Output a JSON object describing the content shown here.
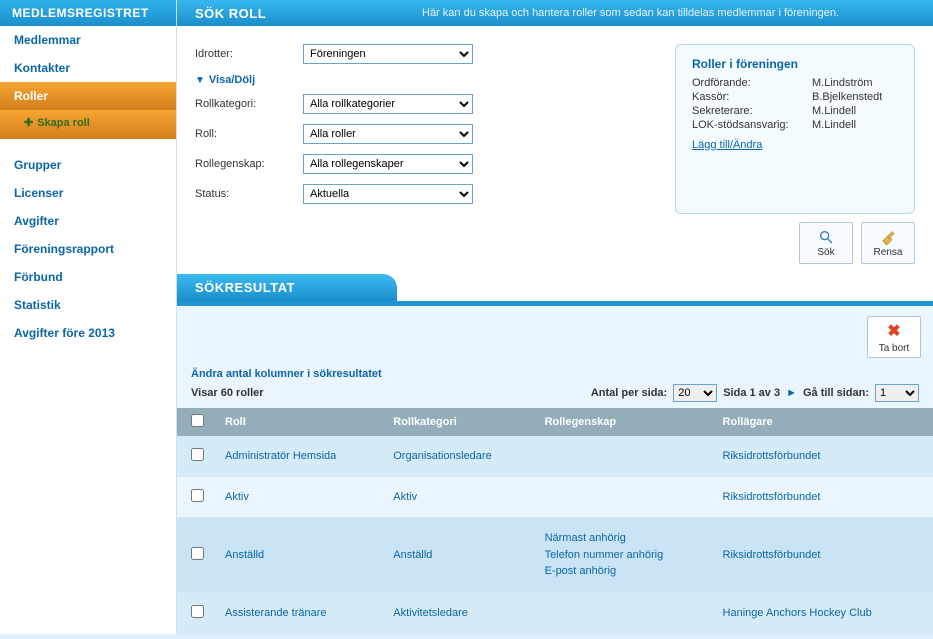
{
  "sidebar": {
    "header": "MEDLEMSREGISTRET",
    "items": [
      {
        "label": "Medlemmar"
      },
      {
        "label": "Kontakter"
      },
      {
        "label": "Roller",
        "active": true,
        "sub": "Skapa roll"
      },
      {
        "label": "Grupper"
      },
      {
        "label": "Licenser"
      },
      {
        "label": "Avgifter"
      },
      {
        "label": "Föreningsrapport"
      },
      {
        "label": "Förbund"
      },
      {
        "label": "Statistik"
      },
      {
        "label": "Avgifter före 2013"
      }
    ]
  },
  "topbar": {
    "title": "SÖK ROLL",
    "desc": "Här kan du skapa och hantera roller som sedan kan tilldelas medlemmar i föreningen."
  },
  "filters": {
    "idrotter_label": "Idrotter:",
    "idrotter_value": "Föreningen",
    "toggle_label": "Visa/Dölj",
    "rollkategori_label": "Rollkategori:",
    "rollkategori_value": "Alla rollkategorier",
    "roll_label": "Roll:",
    "roll_value": "Alla roller",
    "rollegenskap_label": "Rollegenskap:",
    "rollegenskap_value": "Alla rollegenskaper",
    "status_label": "Status:",
    "status_value": "Aktuella"
  },
  "rolebox": {
    "title": "Roller i föreningen",
    "rows": [
      {
        "k": "Ordförande:",
        "v": "M.Lindström"
      },
      {
        "k": "Kassör:",
        "v": "B.Bjelkenstedt"
      },
      {
        "k": "Sekreterare:",
        "v": "M.Lindell"
      },
      {
        "k": "LOK-stödsansvarig:",
        "v": "M.Lindell"
      }
    ],
    "link": "Lägg till/Ändra"
  },
  "buttons": {
    "search": "Sök",
    "clear": "Rensa",
    "delete": "Ta bort"
  },
  "results": {
    "header": "SÖKRESULTAT",
    "change_cols": "Ändra antal kolumner i sökresultatet",
    "count_text": "Visar 60 roller",
    "per_page_label": "Antal per sida:",
    "per_page_value": "20",
    "page_text": "Sida 1 av 3",
    "goto_label": "Gå till sidan:",
    "goto_value": "1",
    "columns": {
      "roll": "Roll",
      "kat": "Rollkategori",
      "egen": "Rollegenskap",
      "agare": "Rollägare"
    },
    "rows": [
      {
        "roll": "Administratör Hemsida",
        "kat": "Organisationsledare",
        "egen": [],
        "agare": "Riksidrottsförbundet"
      },
      {
        "roll": "Aktiv",
        "kat": "Aktiv",
        "egen": [],
        "agare": "Riksidrottsförbundet"
      },
      {
        "roll": "Anställd",
        "kat": "Anställd",
        "egen": [
          "Närmast anhörig",
          "Telefon nummer anhörig",
          "E-post anhörig"
        ],
        "agare": "Riksidrottsförbundet"
      },
      {
        "roll": "Assisterande tränare",
        "kat": "Aktivitetsledare",
        "egen": [],
        "agare": "Haninge Anchors Hockey Club"
      }
    ]
  }
}
